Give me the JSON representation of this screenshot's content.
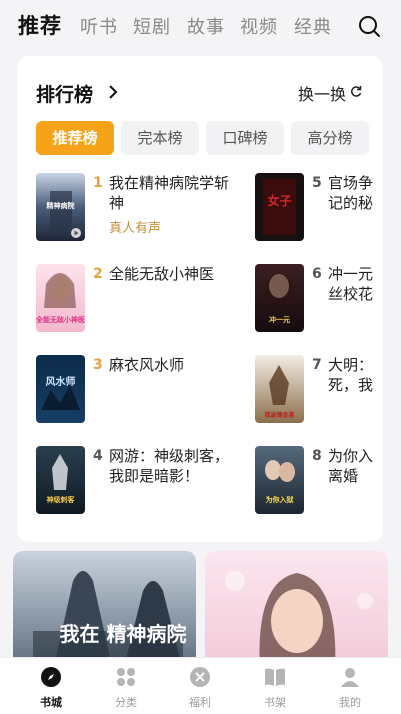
{
  "top_tabs": [
    "推荐",
    "听书",
    "短剧",
    "故事",
    "视频",
    "经典"
  ],
  "ranking": {
    "title": "排行榜",
    "refresh_label": "换一换",
    "filters": [
      "推荐榜",
      "完本榜",
      "口碑榜",
      "高分榜"
    ],
    "books": [
      {
        "rank": "1",
        "title": "我在精神病院学斩神",
        "tag": "真人有声"
      },
      {
        "rank": "2",
        "title": "全能无敌小神医",
        "tag": ""
      },
      {
        "rank": "3",
        "title": "麻衣风水师",
        "tag": ""
      },
      {
        "rank": "4",
        "title": "网游：神级刺客，我即是暗影！",
        "tag": ""
      },
      {
        "rank": "5",
        "title_line1": "官场争",
        "title_line2": "记的秘",
        "tag": ""
      },
      {
        "rank": "6",
        "title_line1": "冲一元",
        "title_line2": "丝校花",
        "tag": ""
      },
      {
        "rank": "7",
        "title_line1": "大明：",
        "title_line2": "死，我",
        "tag": ""
      },
      {
        "rank": "8",
        "title_line1": "为你入",
        "title_line2": "离婚",
        "tag": ""
      }
    ]
  },
  "covers": {
    "c1": "精神病院",
    "c2": "全能无敌小神医",
    "c3": "风水师",
    "c4": "神级刺客",
    "c5": "女子",
    "c6": "冲一元",
    "c7": "我返锋金甚",
    "c8": "为你入狱"
  },
  "promo1_text": "我在 精神病院",
  "bottom_nav": [
    "书城",
    "分类",
    "福利",
    "书架",
    "我的"
  ],
  "colors": {
    "accent": "#f6a31a",
    "tag": "#c9903c"
  }
}
